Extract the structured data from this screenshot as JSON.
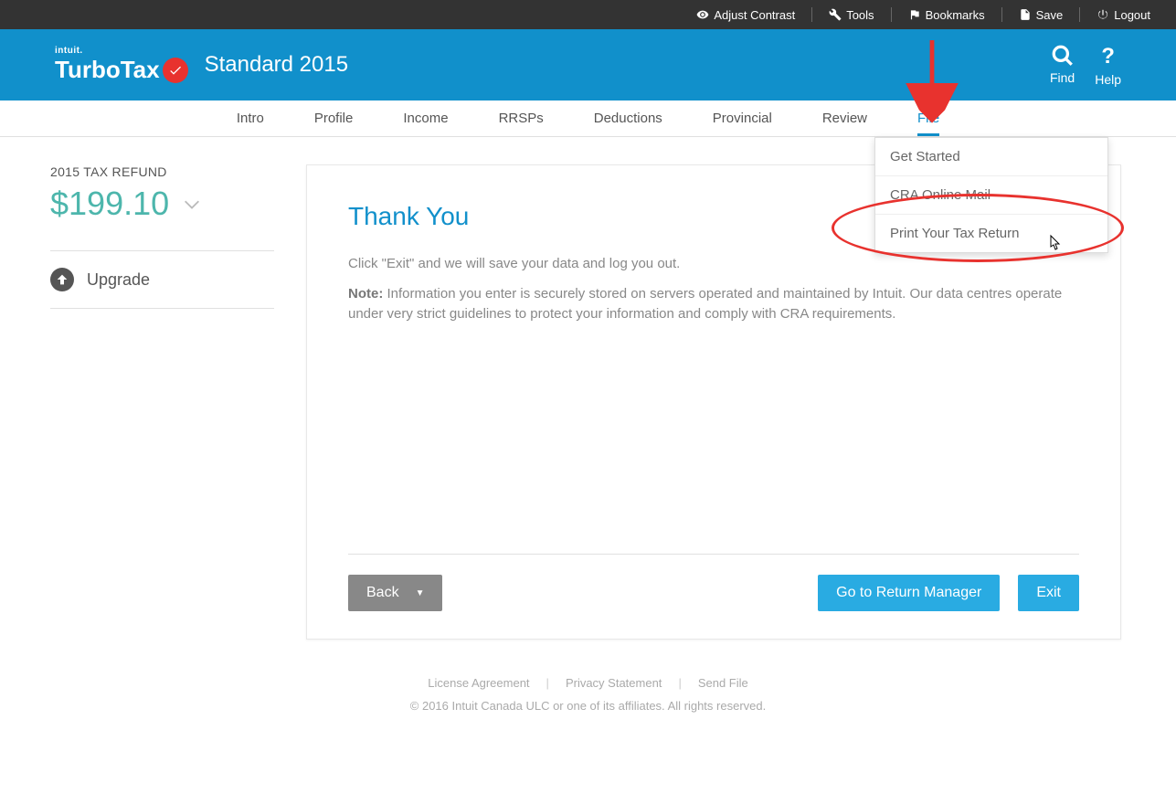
{
  "utilBar": {
    "contrast": "Adjust Contrast",
    "tools": "Tools",
    "bookmarks": "Bookmarks",
    "save": "Save",
    "logout": "Logout"
  },
  "header": {
    "intuit": "intuit.",
    "brand": "TurboTax",
    "product": "Standard 2015",
    "find": "Find",
    "help": "Help"
  },
  "nav": {
    "intro": "Intro",
    "profile": "Profile",
    "income": "Income",
    "rrsps": "RRSPs",
    "deductions": "Deductions",
    "provincial": "Provincial",
    "review": "Review",
    "file": "File"
  },
  "dropdown": {
    "getStarted": "Get Started",
    "craMail": "CRA Online Mail",
    "print": "Print Your Tax Return"
  },
  "sidebar": {
    "refundLabel": "2015 TAX REFUND",
    "refundAmount": "$199.10",
    "upgrade": "Upgrade"
  },
  "main": {
    "title": "Thank You",
    "line1": "Click \"Exit\" and we will save your data and log you out.",
    "noteLabel": "Note:",
    "noteText": " Information you enter is securely stored on servers operated and maintained by Intuit. Our data centres operate under very strict guidelines to protect your information and comply with CRA requirements.",
    "back": "Back",
    "returnManager": "Go to Return Manager",
    "exit": "Exit"
  },
  "footer": {
    "license": "License Agreement",
    "privacy": "Privacy Statement",
    "sendFile": "Send File",
    "copyright": "© 2016 Intuit Canada ULC or one of its affiliates. All rights reserved."
  }
}
